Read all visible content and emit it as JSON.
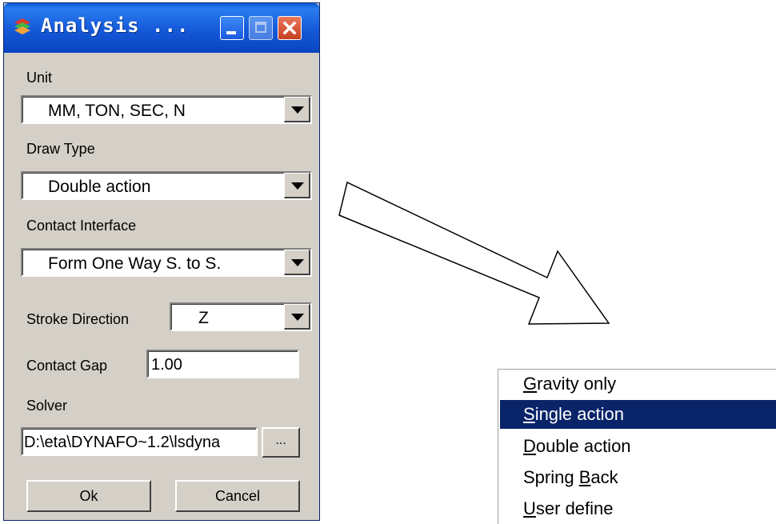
{
  "window": {
    "title": "Analysis ...",
    "controls": [
      "minimize",
      "maximize",
      "close"
    ]
  },
  "unit": {
    "label": "Unit",
    "value": "MM, TON, SEC, N"
  },
  "draw_type": {
    "label": "Draw Type",
    "value": "Double action"
  },
  "contact_interface": {
    "label": "Contact Interface",
    "value": "Form One Way S. to S."
  },
  "stroke_direction": {
    "label": "Stroke Direction",
    "value": "Z"
  },
  "contact_gap": {
    "label": "Contact Gap",
    "value": "1.00"
  },
  "solver": {
    "label": "Solver",
    "path": "D:\\eta\\DYNAFO~1.2\\lsdyna",
    "browse_label": "..."
  },
  "buttons": {
    "ok": "Ok",
    "cancel": "Cancel"
  },
  "draw_type_popup": {
    "items": [
      {
        "mnemonic": "G",
        "rest": "ravity only",
        "selected": false
      },
      {
        "mnemonic": "S",
        "rest": "ingle action",
        "selected": true
      },
      {
        "mnemonic": "D",
        "rest": "ouble action",
        "selected": false
      },
      {
        "prefix": "Spring ",
        "mnemonic": "B",
        "rest": "ack",
        "selected": false
      },
      {
        "mnemonic": "U",
        "rest": "ser define",
        "selected": false
      }
    ]
  },
  "colors": {
    "titlebar": "#1458d8",
    "dialog_bg": "#d4d0c8",
    "selection": "#0a246a"
  },
  "icons": {
    "app": "stacked-layers-icon",
    "arrow": "outline-arrow-right-down"
  }
}
